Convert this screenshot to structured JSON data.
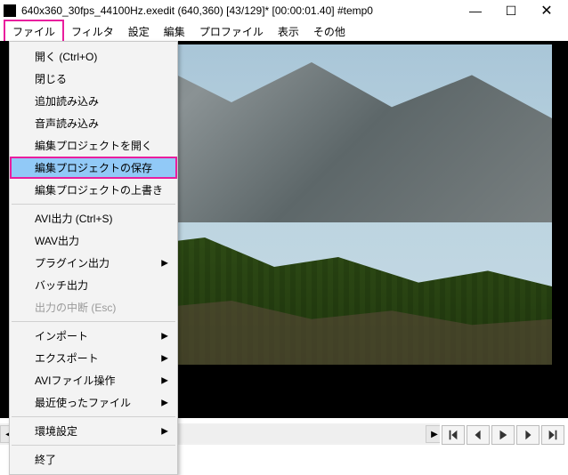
{
  "titlebar": {
    "title": "640x360_30fps_44100Hz.exedit (640,360) [43/129]* [00:00:01.40] #temp0"
  },
  "menubar": {
    "items": [
      "ファイル",
      "フィルタ",
      "設定",
      "編集",
      "プロファイル",
      "表示",
      "その他"
    ],
    "active_index": 0
  },
  "file_menu": {
    "groups": [
      [
        {
          "label": "開く (Ctrl+O)"
        },
        {
          "label": "閉じる"
        },
        {
          "label": "追加読み込み"
        },
        {
          "label": "音声読み込み"
        },
        {
          "label": "編集プロジェクトを開く"
        },
        {
          "label": "編集プロジェクトの保存",
          "highlight": true
        },
        {
          "label": "編集プロジェクトの上書き"
        }
      ],
      [
        {
          "label": "AVI出力 (Ctrl+S)"
        },
        {
          "label": "WAV出力"
        },
        {
          "label": "プラグイン出力",
          "submenu": true
        },
        {
          "label": "バッチ出力"
        },
        {
          "label": "出力の中断 (Esc)",
          "disabled": true
        }
      ],
      [
        {
          "label": "インポート",
          "submenu": true
        },
        {
          "label": "エクスポート",
          "submenu": true
        },
        {
          "label": "AVIファイル操作",
          "submenu": true
        },
        {
          "label": "最近使ったファイル",
          "submenu": true
        }
      ],
      [
        {
          "label": "環境設定",
          "submenu": true
        }
      ],
      [
        {
          "label": "終了"
        }
      ]
    ]
  },
  "playback": {
    "progress_fraction": 0.333
  },
  "controls": {
    "buttons": [
      "skip-start",
      "prev",
      "play",
      "next",
      "skip-end"
    ]
  }
}
